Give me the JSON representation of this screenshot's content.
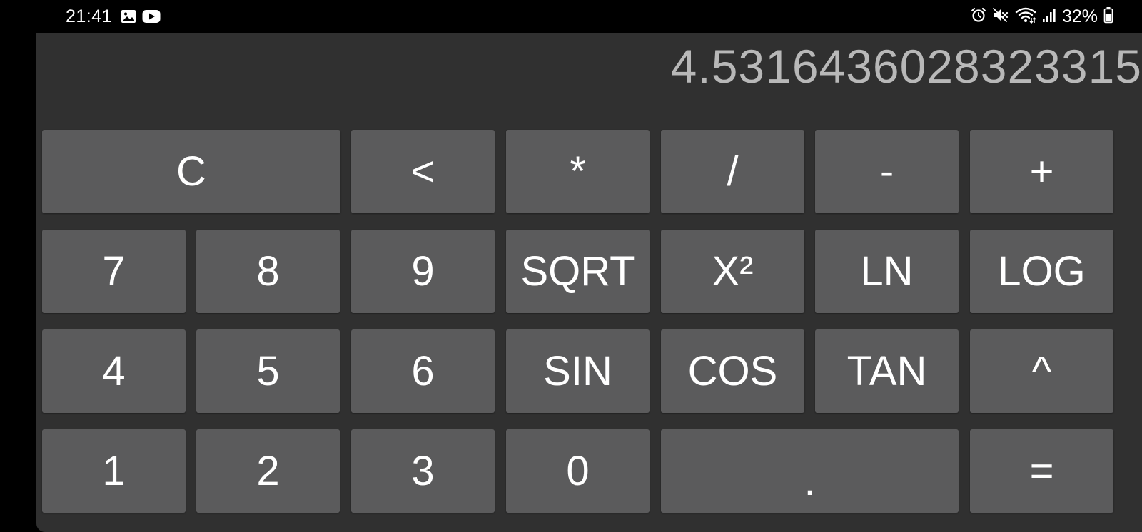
{
  "status_bar": {
    "time": "21:41",
    "left_icons": [
      "gallery-icon",
      "youtube-icon"
    ],
    "right_icons": [
      "alarm-icon",
      "mute-icon",
      "wifi-icon",
      "signal-icon"
    ],
    "battery_percent": "32%"
  },
  "display": {
    "value": "4.5316436028323315"
  },
  "keys": {
    "clear": "C",
    "backspace": "<",
    "multiply": "*",
    "divide": "/",
    "minus": "-",
    "plus": "+",
    "seven": "7",
    "eight": "8",
    "nine": "9",
    "sqrt": "SQRT",
    "square": "X²",
    "ln": "LN",
    "log": "LOG",
    "four": "4",
    "five": "5",
    "six": "6",
    "sin": "SIN",
    "cos": "COS",
    "tan": "TAN",
    "power": "^",
    "one": "1",
    "two": "2",
    "three": "3",
    "zero": "0",
    "decimal": ".",
    "equals": "="
  },
  "colors": {
    "app_background": "#303030",
    "key_background": "#5b5b5c",
    "key_text": "#ffffff",
    "display_text": "#b8b8b8"
  }
}
